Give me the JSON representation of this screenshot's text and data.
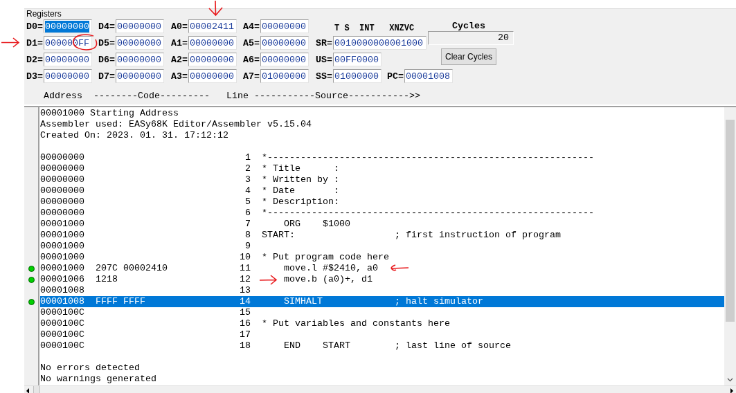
{
  "registers_panel": {
    "title": "Registers",
    "register_columns": [
      [
        {
          "name": "D0=",
          "value": "00000000",
          "selected": true
        },
        {
          "name": "D1=",
          "value": "000000FF",
          "selected": false
        },
        {
          "name": "D2=",
          "value": "00000000",
          "selected": false
        },
        {
          "name": "D3=",
          "value": "00000000",
          "selected": false
        }
      ],
      [
        {
          "name": "D4=",
          "value": "00000000",
          "selected": false
        },
        {
          "name": "D5=",
          "value": "00000000",
          "selected": false
        },
        {
          "name": "D6=",
          "value": "00000000",
          "selected": false
        },
        {
          "name": "D7=",
          "value": "00000000",
          "selected": false
        }
      ],
      [
        {
          "name": "A0=",
          "value": "00002411",
          "selected": false
        },
        {
          "name": "A1=",
          "value": "00000000",
          "selected": false
        },
        {
          "name": "A2=",
          "value": "00000000",
          "selected": false
        },
        {
          "name": "A3=",
          "value": "00000000",
          "selected": false
        }
      ],
      [
        {
          "name": "A4=",
          "value": "00000000",
          "selected": false
        },
        {
          "name": "A5=",
          "value": "00000000",
          "selected": false
        },
        {
          "name": "A6=",
          "value": "00000000",
          "selected": false
        },
        {
          "name": "A7=",
          "value": "01000000",
          "selected": false
        }
      ]
    ],
    "flags_header": "T S  INT   XNZVC",
    "sr": {
      "name": "SR=",
      "value": "0010000000001000"
    },
    "us": {
      "name": "US=",
      "value": "00FF0000"
    },
    "ss": {
      "name": "SS=",
      "value": "01000000"
    },
    "pc": {
      "name": "PC=",
      "value": "00001008"
    },
    "cycles": {
      "label": "Cycles",
      "value": "20"
    },
    "clear_button": "Clear Cycles",
    "column_header": "Address  --------Code---------   Line -----------Source----------->>"
  },
  "listing": {
    "header": [
      "00001000 Starting Address",
      "Assembler used: EASy68K Editor/Assembler v5.15.04",
      "Created On: 2023. 01. 31. 17:12:12"
    ],
    "lines": [
      {
        "address": "00000000",
        "line_no": "1",
        "source": "*-----------------------------------------------------------",
        "breakpoint": false,
        "selected": false
      },
      {
        "address": "00000000",
        "line_no": "2",
        "source": "* Title      :",
        "breakpoint": false,
        "selected": false
      },
      {
        "address": "00000000",
        "line_no": "3",
        "source": "* Written by :",
        "breakpoint": false,
        "selected": false
      },
      {
        "address": "00000000",
        "line_no": "4",
        "source": "* Date       :",
        "breakpoint": false,
        "selected": false
      },
      {
        "address": "00000000",
        "line_no": "5",
        "source": "* Description:",
        "breakpoint": false,
        "selected": false
      },
      {
        "address": "00000000",
        "line_no": "6",
        "source": "*-----------------------------------------------------------",
        "breakpoint": false,
        "selected": false
      },
      {
        "address": "00001000",
        "line_no": "7",
        "source": "ORG    $1000",
        "indented": true,
        "breakpoint": false,
        "selected": false
      },
      {
        "address": "00001000",
        "line_no": "8",
        "source": "START:                  ; first instruction of program",
        "breakpoint": false,
        "selected": false
      },
      {
        "address": "00001000",
        "line_no": "9",
        "breakpoint": false,
        "selected": false
      },
      {
        "address": "00001000",
        "line_no": "10",
        "source": "* Put program code here",
        "breakpoint": false,
        "selected": false
      },
      {
        "address": "00001000",
        "code": "207C 00002410",
        "line_no": "11",
        "source": "move.l #$2410, a0",
        "indented": true,
        "breakpoint": true,
        "selected": false
      },
      {
        "address": "00001006",
        "code": "1218",
        "line_no": "12",
        "source": "move.b (a0)+, d1",
        "indented": true,
        "breakpoint": true,
        "selected": false
      },
      {
        "address": "00001008",
        "line_no": "13",
        "breakpoint": false,
        "selected": false
      },
      {
        "address": "00001008",
        "code": "FFFF FFFF",
        "line_no": "14",
        "source": "SIMHALT             ; halt simulator",
        "indented": true,
        "breakpoint": true,
        "selected": true
      },
      {
        "address": "0000100C",
        "line_no": "15",
        "breakpoint": false,
        "selected": false
      },
      {
        "address": "0000100C",
        "line_no": "16",
        "source": "* Put variables and constants here",
        "breakpoint": false,
        "selected": false
      },
      {
        "address": "0000100C",
        "line_no": "17",
        "breakpoint": false,
        "selected": false
      },
      {
        "address": "0000100C",
        "line_no": "18",
        "source": "END    START        ; last line of source",
        "indented": true,
        "breakpoint": false,
        "selected": false
      }
    ],
    "footer": [
      "No errors detected",
      "No warnings generated"
    ]
  }
}
